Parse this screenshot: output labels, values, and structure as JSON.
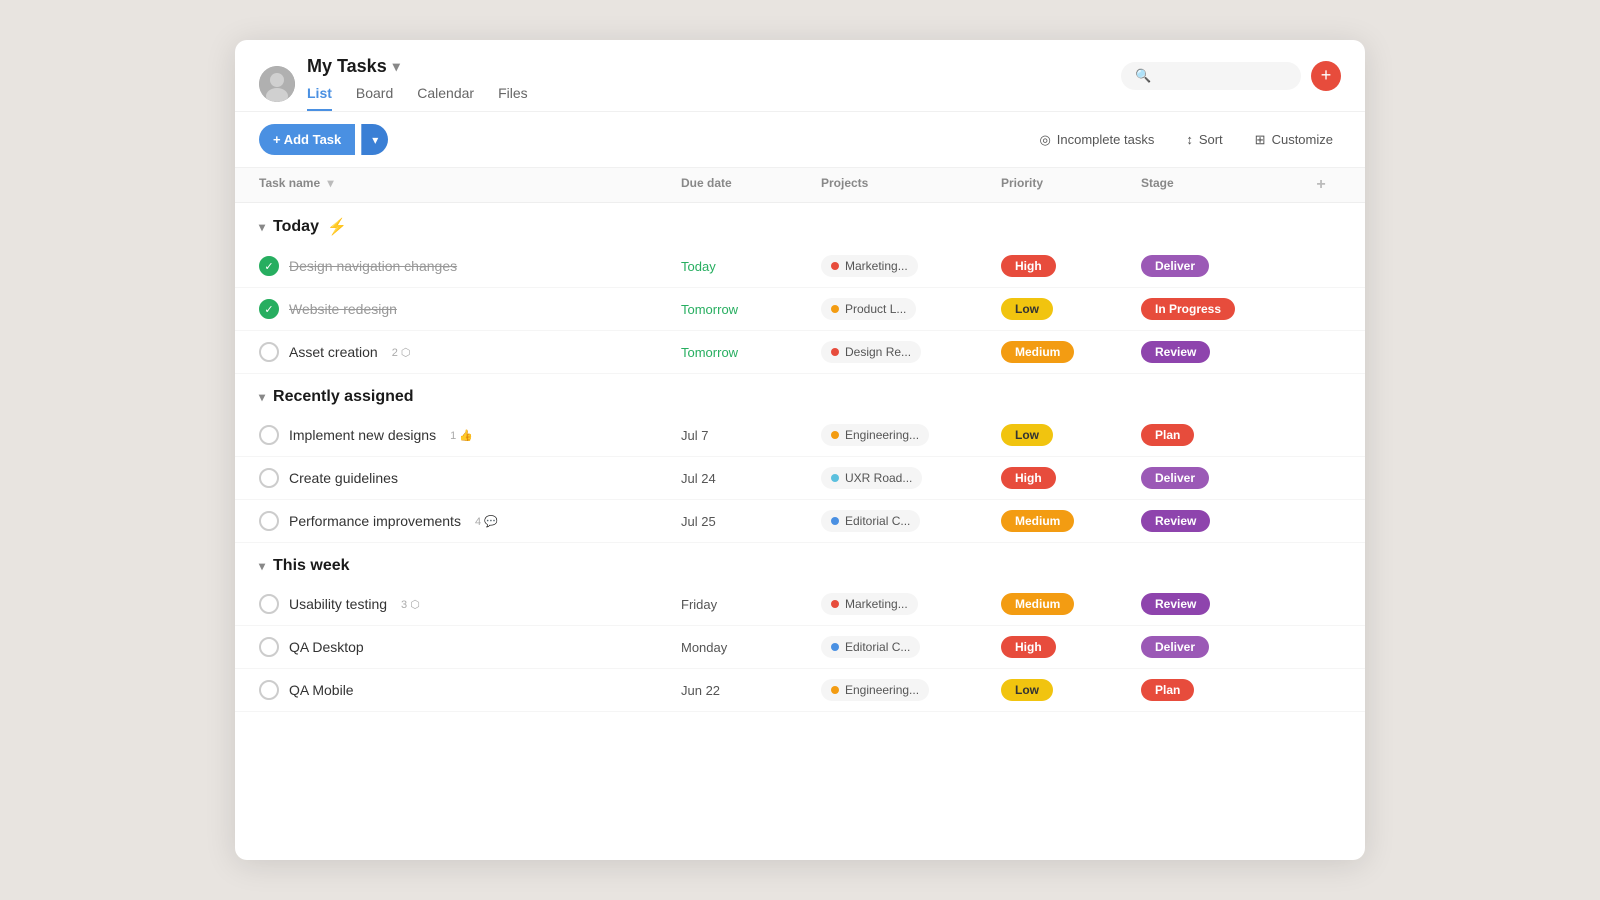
{
  "header": {
    "title": "My Tasks",
    "tabs": [
      {
        "label": "List",
        "active": true
      },
      {
        "label": "Board",
        "active": false
      },
      {
        "label": "Calendar",
        "active": false
      },
      {
        "label": "Files",
        "active": false
      }
    ]
  },
  "toolbar": {
    "add_task_label": "+ Add Task",
    "incomplete_tasks_label": "Incomplete tasks",
    "sort_label": "Sort",
    "customize_label": "Customize"
  },
  "table": {
    "columns": [
      "Task name",
      "Due date",
      "Projects",
      "Priority",
      "Stage",
      "+"
    ]
  },
  "sections": [
    {
      "name": "Today",
      "icon": "⚡",
      "tasks": [
        {
          "name": "Design navigation changes",
          "completed": true,
          "due": "Today",
          "due_class": "due-today",
          "project": "Marketing...",
          "project_color": "#e74c3c",
          "priority": "High",
          "priority_class": "priority-high",
          "stage": "Deliver",
          "stage_class": "stage-deliver",
          "meta": []
        },
        {
          "name": "Website redesign",
          "completed": true,
          "due": "Tomorrow",
          "due_class": "due-tomorrow",
          "project": "Product L...",
          "project_color": "#f39c12",
          "priority": "Low",
          "priority_class": "priority-low",
          "stage": "In Progress",
          "stage_class": "stage-in-progress",
          "meta": []
        },
        {
          "name": "Asset creation",
          "completed": false,
          "due": "Tomorrow",
          "due_class": "due-tomorrow",
          "project": "Design Re...",
          "project_color": "#e74c3c",
          "priority": "Medium",
          "priority_class": "priority-medium",
          "stage": "Review",
          "stage_class": "stage-review",
          "meta": [
            {
              "icon": "subtask",
              "count": "2"
            }
          ]
        }
      ]
    },
    {
      "name": "Recently assigned",
      "icon": "",
      "tasks": [
        {
          "name": "Implement new designs",
          "completed": false,
          "due": "Jul 7",
          "due_class": "due-normal",
          "project": "Engineering...",
          "project_color": "#f39c12",
          "priority": "Low",
          "priority_class": "priority-low",
          "stage": "Plan",
          "stage_class": "stage-plan",
          "meta": [
            {
              "icon": "like",
              "count": "1"
            }
          ]
        },
        {
          "name": "Create guidelines",
          "completed": false,
          "due": "Jul 24",
          "due_class": "due-normal",
          "project": "UXR Road...",
          "project_color": "#5bc0de",
          "priority": "High",
          "priority_class": "priority-high",
          "stage": "Deliver",
          "stage_class": "stage-deliver",
          "meta": []
        },
        {
          "name": "Performance improvements",
          "completed": false,
          "due": "Jul 25",
          "due_class": "due-normal",
          "project": "Editorial C...",
          "project_color": "#4a90e2",
          "priority": "Medium",
          "priority_class": "priority-medium",
          "stage": "Review",
          "stage_class": "stage-review",
          "meta": [
            {
              "icon": "comment",
              "count": "4"
            }
          ]
        }
      ]
    },
    {
      "name": "This week",
      "icon": "",
      "tasks": [
        {
          "name": "Usability testing",
          "completed": false,
          "due": "Friday",
          "due_class": "due-normal",
          "project": "Marketing...",
          "project_color": "#e74c3c",
          "priority": "Medium",
          "priority_class": "priority-medium",
          "stage": "Review",
          "stage_class": "stage-review",
          "meta": [
            {
              "icon": "subtask",
              "count": "3"
            }
          ]
        },
        {
          "name": "QA Desktop",
          "completed": false,
          "due": "Monday",
          "due_class": "due-normal",
          "project": "Editorial C...",
          "project_color": "#4a90e2",
          "priority": "High",
          "priority_class": "priority-high",
          "stage": "Deliver",
          "stage_class": "stage-deliver",
          "meta": []
        },
        {
          "name": "QA Mobile",
          "completed": false,
          "due": "Jun 22",
          "due_class": "due-normal",
          "project": "Engineering...",
          "project_color": "#f39c12",
          "priority": "Low",
          "priority_class": "priority-low",
          "stage": "Plan",
          "stage_class": "stage-plan",
          "meta": []
        }
      ]
    }
  ]
}
